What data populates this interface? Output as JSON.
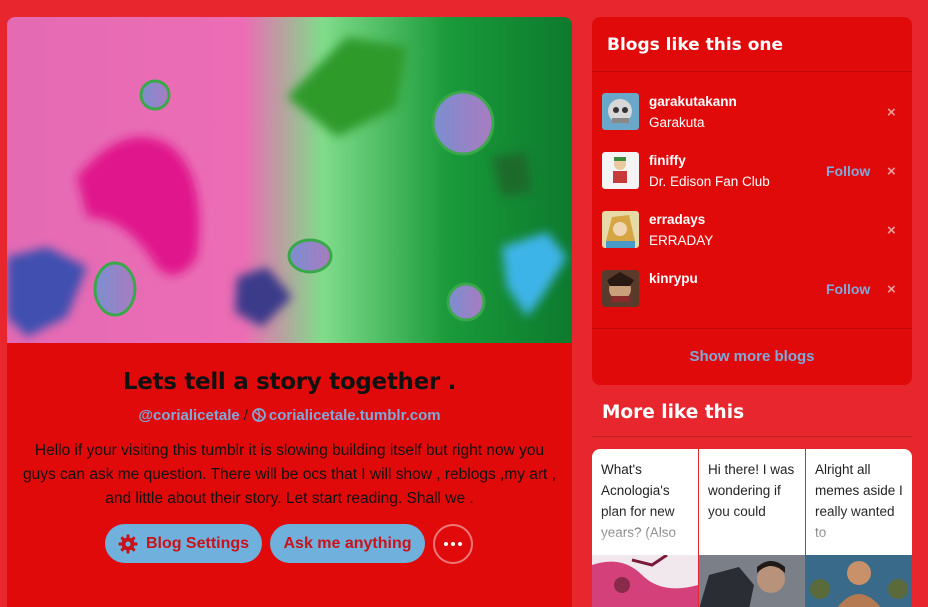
{
  "blog": {
    "title": "Lets tell a story together .",
    "username": "@corialicetale",
    "separator": "/",
    "url": "corialicetale.tumblr.com",
    "description": "Hello if your visiting this tumblr it is slowing building itself but right now you guys can ask me question. There will be ocs that I will show , reblogs ,my art , and little about their story. Let start reading. Shall we .",
    "settings_label": "Blog Settings",
    "ask_label": "Ask me anything",
    "more_icon": "ellipsis-icon"
  },
  "similar": {
    "heading": "Blogs like this one",
    "blogs": [
      {
        "name": "garakutakann",
        "title": "Garakuta",
        "follow": "",
        "dismiss": "×"
      },
      {
        "name": "finiffy",
        "title": "Dr. Edison Fan Club",
        "follow": "Follow",
        "dismiss": "×"
      },
      {
        "name": "erradays",
        "title": "ERRADAY",
        "follow": "",
        "dismiss": "×"
      },
      {
        "name": "kinrypu",
        "title": "",
        "follow": "Follow",
        "dismiss": "×"
      }
    ],
    "show_more": "Show more blogs"
  },
  "more": {
    "heading": "More like this",
    "tiles": [
      {
        "text": "What's Acnologia's plan for new years? (Also"
      },
      {
        "text": "Hi there! I was wondering if you could"
      },
      {
        "text": "Alright all memes aside I really wanted to"
      }
    ]
  },
  "colors": {
    "page_bg": "#e8262e",
    "card_bg": "#e00a0b",
    "link_blue": "#7fa9d8",
    "button_bg": "#6fb0dc"
  }
}
